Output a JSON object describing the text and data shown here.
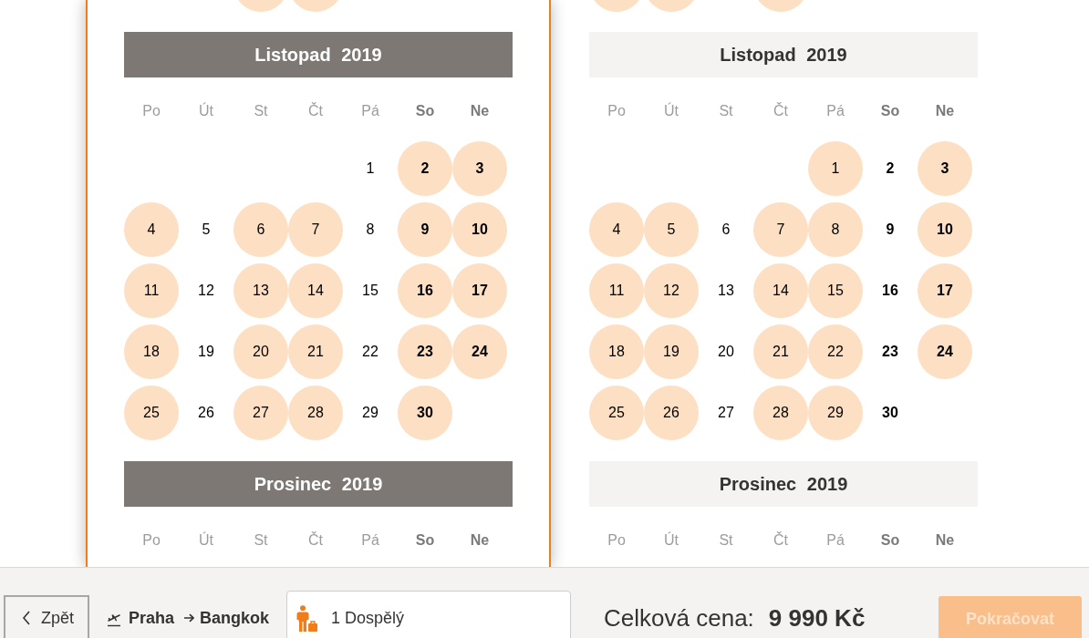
{
  "calendars": [
    {
      "selected": true,
      "partial_row": [
        {
          "available": false
        },
        {
          "available": false
        },
        {
          "available": true
        },
        {
          "available": true
        },
        {
          "available": false
        },
        {
          "available": false
        },
        {
          "available": false
        }
      ],
      "months": [
        {
          "title": "Listopad 2019",
          "weekdays": [
            {
              "label": "Po",
              "weekend": false
            },
            {
              "label": "Út",
              "weekend": false
            },
            {
              "label": "St",
              "weekend": false
            },
            {
              "label": "Čt",
              "weekend": false
            },
            {
              "label": "Pá",
              "weekend": false
            },
            {
              "label": "So",
              "weekend": true
            },
            {
              "label": "Ne",
              "weekend": true
            }
          ],
          "weeks": [
            [
              {
                "kind": "blank"
              },
              {
                "kind": "blank"
              },
              {
                "kind": "blank"
              },
              {
                "kind": "blank"
              },
              {
                "kind": "day",
                "day": "1",
                "available": false
              },
              {
                "kind": "day",
                "day": "2",
                "available": true
              },
              {
                "kind": "day",
                "day": "3",
                "available": true
              }
            ],
            [
              {
                "kind": "day",
                "day": "4",
                "available": true
              },
              {
                "kind": "day",
                "day": "5",
                "available": false
              },
              {
                "kind": "day",
                "day": "6",
                "available": true
              },
              {
                "kind": "day",
                "day": "7",
                "available": true
              },
              {
                "kind": "day",
                "day": "8",
                "available": false
              },
              {
                "kind": "day",
                "day": "9",
                "available": true
              },
              {
                "kind": "day",
                "day": "10",
                "available": true
              }
            ],
            [
              {
                "kind": "day",
                "day": "11",
                "available": true
              },
              {
                "kind": "day",
                "day": "12",
                "available": false
              },
              {
                "kind": "day",
                "day": "13",
                "available": true
              },
              {
                "kind": "day",
                "day": "14",
                "available": true
              },
              {
                "kind": "day",
                "day": "15",
                "available": false
              },
              {
                "kind": "day",
                "day": "16",
                "available": true
              },
              {
                "kind": "day",
                "day": "17",
                "available": true
              }
            ],
            [
              {
                "kind": "day",
                "day": "18",
                "available": true
              },
              {
                "kind": "day",
                "day": "19",
                "available": false
              },
              {
                "kind": "day",
                "day": "20",
                "available": true
              },
              {
                "kind": "day",
                "day": "21",
                "available": true
              },
              {
                "kind": "day",
                "day": "22",
                "available": false
              },
              {
                "kind": "day",
                "day": "23",
                "available": true
              },
              {
                "kind": "day",
                "day": "24",
                "available": true
              }
            ],
            [
              {
                "kind": "day",
                "day": "25",
                "available": true
              },
              {
                "kind": "day",
                "day": "26",
                "available": false
              },
              {
                "kind": "day",
                "day": "27",
                "available": true
              },
              {
                "kind": "day",
                "day": "28",
                "available": true
              },
              {
                "kind": "day",
                "day": "29",
                "available": false
              },
              {
                "kind": "day",
                "day": "30",
                "available": true
              },
              {
                "kind": "blank"
              }
            ]
          ]
        },
        {
          "title": "Prosinec 2019",
          "weekdays": [
            {
              "label": "Po",
              "weekend": false
            },
            {
              "label": "Út",
              "weekend": false
            },
            {
              "label": "St",
              "weekend": false
            },
            {
              "label": "Čt",
              "weekend": false
            },
            {
              "label": "Pá",
              "weekend": false
            },
            {
              "label": "So",
              "weekend": true
            },
            {
              "label": "Ne",
              "weekend": true
            }
          ]
        }
      ]
    },
    {
      "selected": false,
      "partial_row": [
        {
          "available": true
        },
        {
          "available": true
        },
        {
          "available": false
        },
        {
          "available": true
        },
        {
          "available": false
        },
        {
          "available": false
        },
        {
          "available": false
        }
      ],
      "months": [
        {
          "title": "Listopad 2019",
          "weekdays": [
            {
              "label": "Po",
              "weekend": false
            },
            {
              "label": "Út",
              "weekend": false
            },
            {
              "label": "St",
              "weekend": false
            },
            {
              "label": "Čt",
              "weekend": false
            },
            {
              "label": "Pá",
              "weekend": false
            },
            {
              "label": "So",
              "weekend": true
            },
            {
              "label": "Ne",
              "weekend": true
            }
          ],
          "weeks": [
            [
              {
                "kind": "blank"
              },
              {
                "kind": "blank"
              },
              {
                "kind": "blank"
              },
              {
                "kind": "blank"
              },
              {
                "kind": "day",
                "day": "1",
                "available": true
              },
              {
                "kind": "day",
                "day": "2",
                "available": false
              },
              {
                "kind": "day",
                "day": "3",
                "available": true
              }
            ],
            [
              {
                "kind": "day",
                "day": "4",
                "available": true
              },
              {
                "kind": "day",
                "day": "5",
                "available": true
              },
              {
                "kind": "day",
                "day": "6",
                "available": false
              },
              {
                "kind": "day",
                "day": "7",
                "available": true
              },
              {
                "kind": "day",
                "day": "8",
                "available": true
              },
              {
                "kind": "day",
                "day": "9",
                "available": false
              },
              {
                "kind": "day",
                "day": "10",
                "available": true
              }
            ],
            [
              {
                "kind": "day",
                "day": "11",
                "available": true
              },
              {
                "kind": "day",
                "day": "12",
                "available": true
              },
              {
                "kind": "day",
                "day": "13",
                "available": false
              },
              {
                "kind": "day",
                "day": "14",
                "available": true
              },
              {
                "kind": "day",
                "day": "15",
                "available": true
              },
              {
                "kind": "day",
                "day": "16",
                "available": false
              },
              {
                "kind": "day",
                "day": "17",
                "available": true
              }
            ],
            [
              {
                "kind": "day",
                "day": "18",
                "available": true
              },
              {
                "kind": "day",
                "day": "19",
                "available": true
              },
              {
                "kind": "day",
                "day": "20",
                "available": false
              },
              {
                "kind": "day",
                "day": "21",
                "available": true
              },
              {
                "kind": "day",
                "day": "22",
                "available": true
              },
              {
                "kind": "day",
                "day": "23",
                "available": false
              },
              {
                "kind": "day",
                "day": "24",
                "available": true
              }
            ],
            [
              {
                "kind": "day",
                "day": "25",
                "available": true
              },
              {
                "kind": "day",
                "day": "26",
                "available": true
              },
              {
                "kind": "day",
                "day": "27",
                "available": false
              },
              {
                "kind": "day",
                "day": "28",
                "available": true
              },
              {
                "kind": "day",
                "day": "29",
                "available": true
              },
              {
                "kind": "day",
                "day": "30",
                "available": false
              },
              {
                "kind": "blank"
              }
            ]
          ]
        },
        {
          "title": "Prosinec 2019",
          "weekdays": [
            {
              "label": "Po",
              "weekend": false
            },
            {
              "label": "Út",
              "weekend": false
            },
            {
              "label": "St",
              "weekend": false
            },
            {
              "label": "Čt",
              "weekend": false
            },
            {
              "label": "Pá",
              "weekend": false
            },
            {
              "label": "So",
              "weekend": true
            },
            {
              "label": "Ne",
              "weekend": true
            }
          ]
        }
      ]
    }
  ],
  "bottom_bar": {
    "back_button": {
      "label": "Zpět"
    },
    "route": {
      "from": "Praha",
      "to": "Bangkok"
    },
    "passengers": {
      "value": "1 Dospělý"
    },
    "total": {
      "label": "Celková cena:",
      "amount": "9 990 Kč"
    },
    "continue_button": {
      "label": "Pokračovat",
      "disabled": true
    }
  }
}
